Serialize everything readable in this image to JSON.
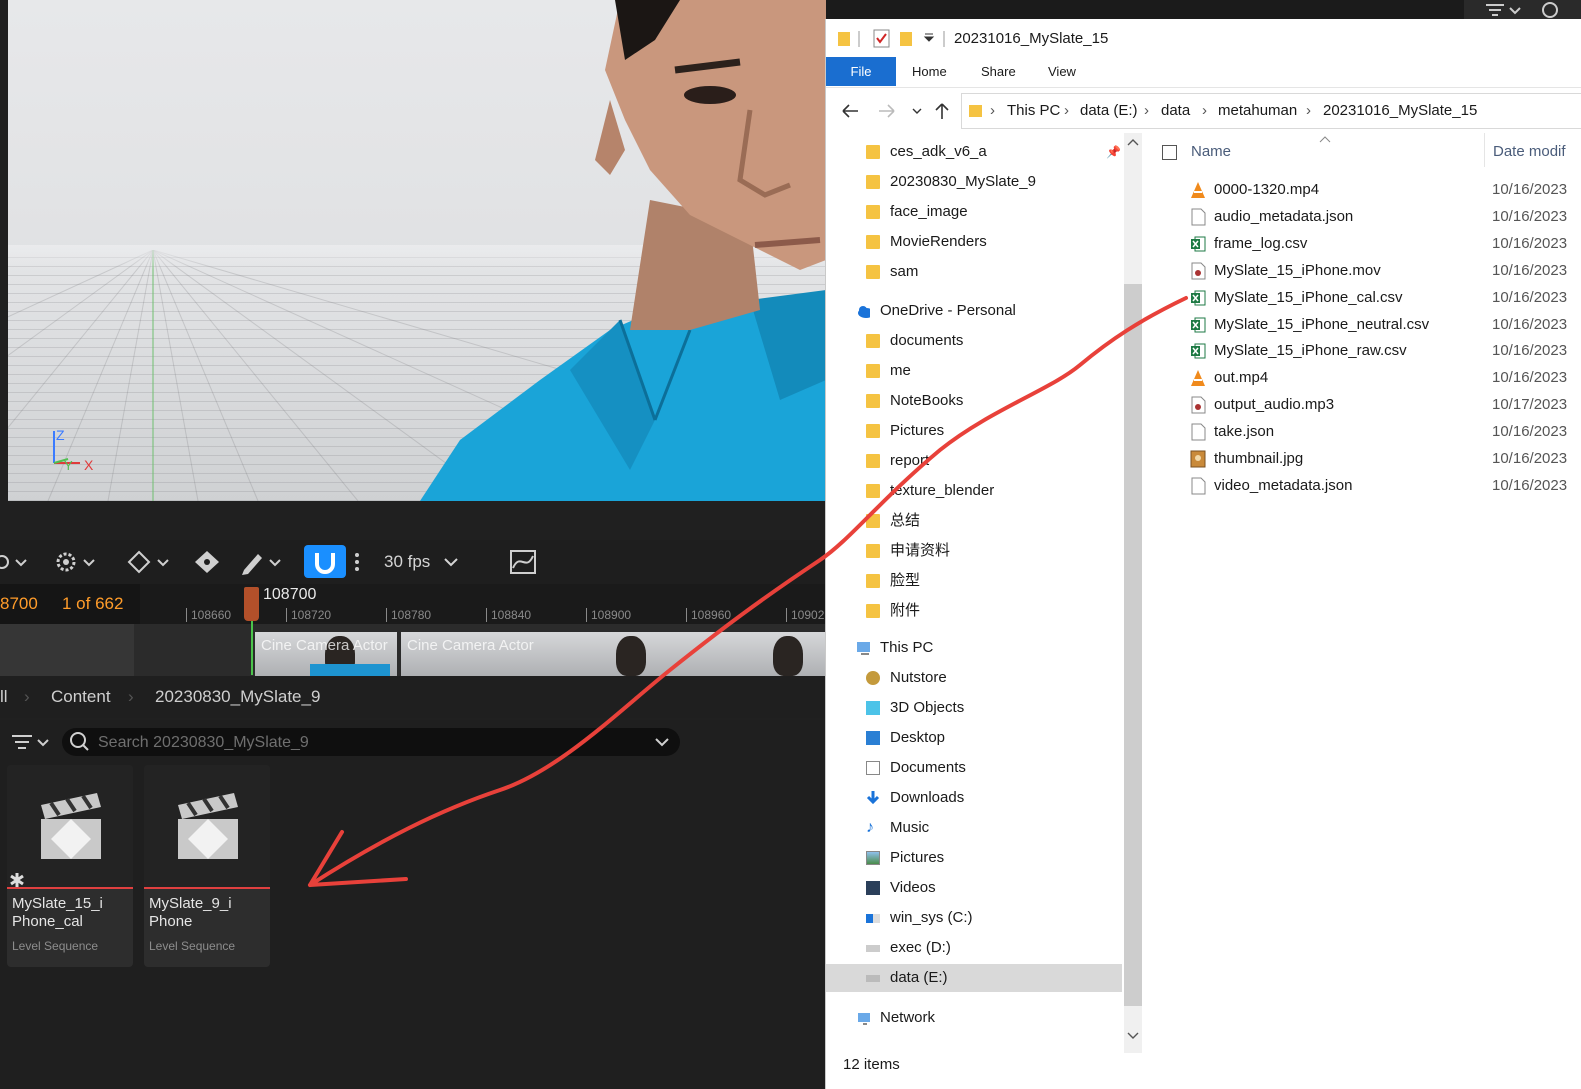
{
  "ue": {
    "viewport": {
      "axis_z": "Z",
      "axis_y": "Y",
      "axis_x": "X"
    },
    "toolbar": {
      "fps": "30 fps"
    },
    "timeline": {
      "frame": "8700",
      "of_count": "1 of 662",
      "playhead": "108700",
      "ticks": [
        "108660",
        "108720",
        "108780",
        "108840",
        "108900",
        "108960",
        "10902"
      ],
      "clip1": "Cine Camera Actor",
      "clip2": "Cine Camera Actor"
    },
    "breadcrumb": {
      "root": "ll",
      "content": "Content",
      "folder": "20230830_MySlate_9"
    },
    "search": {
      "placeholder": "Search 20230830_MySlate_9"
    },
    "assets": [
      {
        "name": "MySlate_15_i\nPhone_cal",
        "type": "Level Sequence"
      },
      {
        "name": "MySlate_9_i\nPhone",
        "type": "Level Sequence"
      }
    ]
  },
  "explorer": {
    "title": "20231016_MySlate_15",
    "ribbon": {
      "file": "File",
      "home": "Home",
      "share": "Share",
      "view": "View"
    },
    "address": [
      "This PC",
      "data (E:)",
      "data",
      "metahuman",
      "20231016_MySlate_15"
    ],
    "nav": {
      "quick": [
        "ces_adk_v6_a",
        "20230830_MySlate_9",
        "face_image",
        "MovieRenders",
        "sam"
      ],
      "onedrive": "OneDrive - Personal",
      "onedrive_items": [
        "documents",
        "me",
        "NoteBooks",
        "Pictures",
        "report",
        "texture_blender",
        "总结",
        "申请资料",
        "脸型",
        "附件"
      ],
      "thispc": "This PC",
      "pc_items": [
        "Nutstore",
        "3D Objects",
        "Desktop",
        "Documents",
        "Downloads",
        "Music",
        "Pictures",
        "Videos",
        "win_sys (C:)",
        "exec (D:)",
        "data (E:)"
      ],
      "network": "Network"
    },
    "columns": {
      "name": "Name",
      "date": "Date modif"
    },
    "files": [
      {
        "name": "0000-1320.mp4",
        "date": "10/16/2023",
        "icon": "vlc-icon"
      },
      {
        "name": "audio_metadata.json",
        "date": "10/16/2023",
        "icon": "file-icon"
      },
      {
        "name": "frame_log.csv",
        "date": "10/16/2023",
        "icon": "excel-icon"
      },
      {
        "name": "MySlate_15_iPhone.mov",
        "date": "10/16/2023",
        "icon": "media-icon"
      },
      {
        "name": "MySlate_15_iPhone_cal.csv",
        "date": "10/16/2023",
        "icon": "excel-icon"
      },
      {
        "name": "MySlate_15_iPhone_neutral.csv",
        "date": "10/16/2023",
        "icon": "excel-icon"
      },
      {
        "name": "MySlate_15_iPhone_raw.csv",
        "date": "10/16/2023",
        "icon": "excel-icon"
      },
      {
        "name": "out.mp4",
        "date": "10/16/2023",
        "icon": "vlc-icon"
      },
      {
        "name": "output_audio.mp3",
        "date": "10/17/2023",
        "icon": "media-icon"
      },
      {
        "name": "take.json",
        "date": "10/16/2023",
        "icon": "file-icon"
      },
      {
        "name": "thumbnail.jpg",
        "date": "10/16/2023",
        "icon": "image-icon"
      },
      {
        "name": "video_metadata.json",
        "date": "10/16/2023",
        "icon": "file-icon"
      }
    ],
    "status": "12 items"
  }
}
